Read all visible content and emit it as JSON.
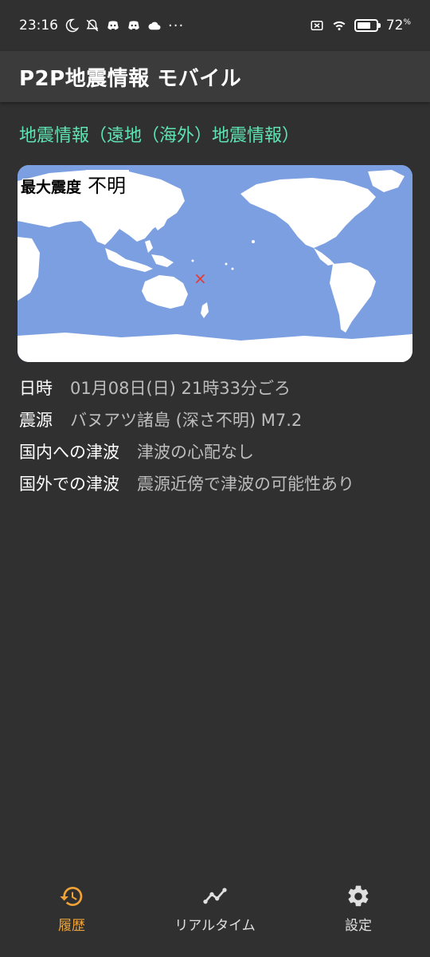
{
  "status_bar": {
    "time": "23:16",
    "battery": "72",
    "battery_unit": "%",
    "icons": [
      "moon-icon",
      "bell-off-icon",
      "discord-icon",
      "discord-icon",
      "cloud-icon",
      "more-dots-icon",
      "sim-off-icon",
      "wifi-icon",
      "battery-icon"
    ],
    "more": "···"
  },
  "app_bar": {
    "title": "P2P地震情報 モバイル"
  },
  "section": {
    "title": "地震情報（遠地（海外）地震情報）"
  },
  "map": {
    "max_intensity_label": "最大震度",
    "max_intensity_value": "不明",
    "epicenter_marker": "×",
    "colors": {
      "ocean": "#7b9fe0",
      "land": "#ffffff",
      "marker": "#e53935"
    }
  },
  "details": [
    {
      "label": "日時",
      "value": "01月08日(日) 21時33分ごろ"
    },
    {
      "label": "震源",
      "value": "バヌアツ諸島 (深さ不明) M7.2"
    },
    {
      "label": "国内への津波",
      "value": "津波の心配なし"
    },
    {
      "label": "国外での津波",
      "value": "震源近傍で津波の可能性あり"
    }
  ],
  "bottom_nav": [
    {
      "label": "履歴",
      "icon": "history-icon",
      "active": true
    },
    {
      "label": "リアルタイム",
      "icon": "timeline-icon",
      "active": false
    },
    {
      "label": "設定",
      "icon": "gear-icon",
      "active": false
    }
  ],
  "accent": "#5fe3b5",
  "nav_active_color": "#f0a336"
}
